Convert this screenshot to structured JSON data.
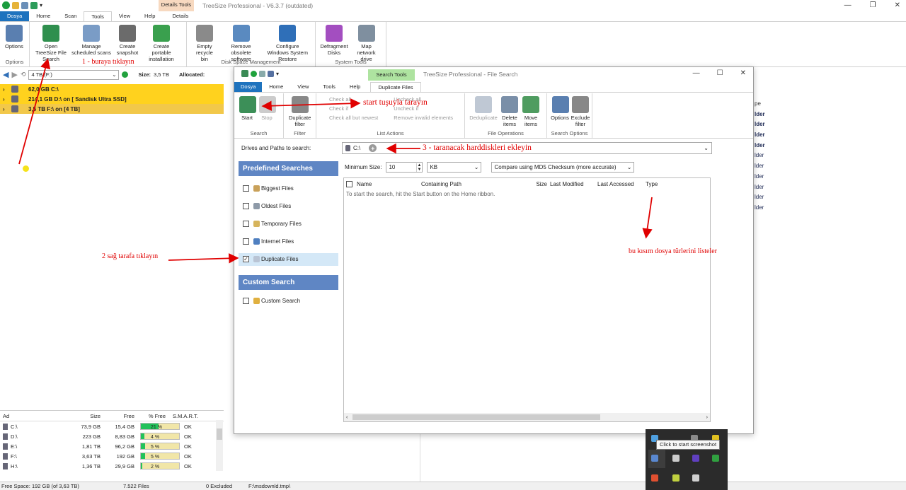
{
  "app": {
    "title": "TreeSize Professional  - V6.3.7 (outdated)",
    "context_tab": "Details Tools",
    "tabs": [
      "Dosya",
      "Home",
      "Scan",
      "Tools",
      "View",
      "Help",
      "Details"
    ]
  },
  "ribbon": {
    "buttons": [
      {
        "label": "Options"
      },
      {
        "label": "Open TreeSize File Search"
      },
      {
        "label": "Manage scheduled scans"
      },
      {
        "label": "Create snapshot"
      },
      {
        "label": "Create portable installation"
      },
      {
        "label": "Empty recycle bin"
      },
      {
        "label": "Remove obsolete software"
      },
      {
        "label": "Configure Windows System Restore"
      },
      {
        "label": "Defragment Disks"
      },
      {
        "label": "Map network drive"
      }
    ],
    "groups": [
      "Options",
      "Disk Space Management",
      "System Tools"
    ]
  },
  "addressbar": {
    "drive": "4 TB (F:)",
    "size_label": "Size:",
    "size_value": "3,5 TB",
    "alloc_label": "Allocated:"
  },
  "tree": [
    {
      "text": "62,0 GB   C:\\"
    },
    {
      "text": "214,1 GB   D:\\  on  [  Sandisk Ultra SSD]"
    },
    {
      "text": "3,5 TB   F:\\  on  [4 TB]"
    }
  ],
  "drives_table": {
    "headers": [
      "Ad",
      "Size",
      "Free",
      "% Free",
      "S.M.A.R.T."
    ],
    "rows": [
      {
        "name": "C:\\",
        "size": "73,9 GB",
        "free": "15,4 GB",
        "pct": "21 %",
        "smart": "OK",
        "fill": 0.21
      },
      {
        "name": "D:\\",
        "size": "223 GB",
        "free": "8,83 GB",
        "pct": "4 %",
        "smart": "OK",
        "fill": 0.04
      },
      {
        "name": "E:\\",
        "size": "1,81 TB",
        "free": "96,2 GB",
        "pct": "5 %",
        "smart": "OK",
        "fill": 0.05
      },
      {
        "name": "F:\\",
        "size": "3,63 TB",
        "free": "192 GB",
        "pct": "5 %",
        "smart": "OK",
        "fill": 0.05
      },
      {
        "name": "H:\\",
        "size": "1,36 TB",
        "free": "29,9 GB",
        "pct": "2 %",
        "smart": "OK",
        "fill": 0.02
      }
    ]
  },
  "statusbar": {
    "free": "Free Space: 192 GB  (of 3,63 TB)",
    "files": "7.522  Files",
    "excluded": "0 Excluded",
    "path": "F:\\msdownld.tmp\\"
  },
  "right_column": {
    "header": "pe",
    "items": [
      "lder",
      "lder",
      "lder",
      "lder",
      "lder",
      "lder",
      "lder",
      "lder",
      "lder",
      "lder"
    ]
  },
  "search_window": {
    "context_tab": "Search Tools",
    "title": "TreeSize Professional - File Search",
    "tabs": [
      "Dosya",
      "Home",
      "View",
      "Tools",
      "Help",
      "Duplicate Files"
    ],
    "ribbon": {
      "start": "Start",
      "stop": "Stop",
      "dup_filter": "Duplicate filter",
      "check_all": "Check all",
      "check_if": "Check if",
      "check_all_newest": "Check all but newest",
      "uncheck_all": "Uncheck all",
      "uncheck_if": "Uncheck if",
      "remove_invalid": "Remove invalid elements",
      "deduplicate": "Deduplicate",
      "delete_items": "Delete items",
      "move_items": "Move items",
      "options": "Options",
      "exclude_filter": "Exclude filter",
      "groups": [
        "Search",
        "Filter",
        "List Actions",
        "File Operations",
        "Search Options"
      ]
    },
    "drives_label": "Drives and Paths to search:",
    "path": "C:\\",
    "predefined_header": "Predefined Searches",
    "predefined": [
      "Biggest Files",
      "Oldest Files",
      "Temporary Files",
      "Internet Files",
      "Duplicate Files"
    ],
    "custom_header": "Custom Search",
    "custom": [
      "Custom Search"
    ],
    "min_size_label": "Minimum Size:",
    "min_size_value": "10",
    "unit": "KB",
    "compare": "Compare using MD5 Checksum (more accurate)",
    "columns": [
      "Name",
      "Containing Path",
      "Size",
      "Last Modified",
      "Last Accessed",
      "Type"
    ],
    "hint": "To start the search, hit the Start button on the Home ribbon."
  },
  "annotations": {
    "a1": "1 - buraya tıklayın",
    "a2": "2 sağ tarafa tıklayın",
    "a3": "start tuşuyla tarayın",
    "a4": "3 - taranacak harddiskleri ekleyin",
    "a5": "bu kısım dosya türlerini listeler"
  },
  "tooltip": "Click to start screenshot"
}
